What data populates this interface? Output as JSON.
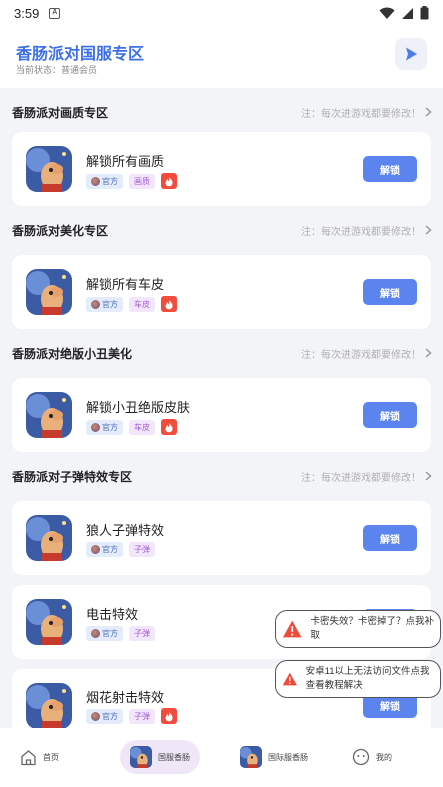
{
  "status": {
    "time": "3:59",
    "notif_letter": "A"
  },
  "header": {
    "title": "香肠派对国服专区",
    "subtitle": "当前状态：普通会员"
  },
  "sections": [
    {
      "title": "香肠派对画质专区",
      "note": "注：每次进游戏都要修改！"
    },
    {
      "title": "香肠派对美化专区",
      "note": "注：每次进游戏都要修改！"
    },
    {
      "title": "香肠派对绝版小丑美化",
      "note": "注：每次进游戏都要修改！"
    },
    {
      "title": "香肠派对子弹特效专区",
      "note": "注：每次进游戏都要修改！"
    }
  ],
  "items": [
    {
      "name": "解锁所有画质",
      "official": "官方",
      "category": "画质",
      "hot": true,
      "button": "解锁"
    },
    {
      "name": "解锁所有车皮",
      "official": "官方",
      "category": "车皮",
      "hot": true,
      "button": "解锁"
    },
    {
      "name": "解锁小丑绝版皮肤",
      "official": "官方",
      "category": "车皮",
      "hot": true,
      "button": "解锁"
    },
    {
      "name": "狼人子弹特效",
      "official": "官方",
      "category": "子弹",
      "hot": false,
      "button": "解锁"
    },
    {
      "name": "电击特效",
      "official": "官方",
      "category": "子弹",
      "hot": false,
      "button": "解锁"
    },
    {
      "name": "烟花射击特效",
      "official": "官方",
      "category": "子弹",
      "hot": true,
      "button": "解锁"
    }
  ],
  "toasts": [
    {
      "message": "卡密失效？卡密掉了？点我补取"
    },
    {
      "message": "安卓11以上无法访问文件点我查看教程解决"
    }
  ],
  "nav": [
    {
      "label": "首页"
    },
    {
      "label": "国服香肠"
    },
    {
      "label": "国际服香肠"
    },
    {
      "label": "我的"
    }
  ],
  "colors": {
    "accent": "#5b84ee",
    "title_blue": "#3d6fe8",
    "hot_red": "#f24c3d",
    "category_purple": "#a55bd4"
  }
}
